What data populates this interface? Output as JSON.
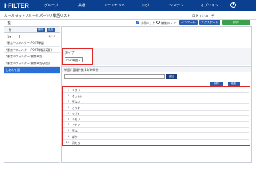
{
  "header": {
    "logo": "i-FILTER",
    "nav": [
      {
        "label": "グループ",
        "caret": "⌄"
      },
      {
        "label": "共通",
        "caret": "⌄"
      },
      {
        "label": "ルールセット",
        "caret": "⌄"
      },
      {
        "label": "ログ",
        "caret": "⌄"
      },
      {
        "label": "システム",
        "caret": "⌄"
      },
      {
        "label": "オプション",
        "caret": "⌄"
      }
    ],
    "power_icon": "power-icon"
  },
  "breadcrumb": "ルールセット / ルールパーツ / 単語リスト",
  "login_info": "ログインユーザー:",
  "toolbar": {
    "list_title": "一覧",
    "audit_lock_label": "参照ロック",
    "edit_lock_label": "編集ロック",
    "import_label": "インポート",
    "export_label": "エクスポート",
    "save_label": "保存"
  },
  "left_panel": {
    "header_label": "一覧",
    "delete_label": "削除",
    "add_label": "追加",
    "page_select": "1 ▾",
    "page_text": "1 / 10",
    "items": [
      {
        "label": "*暴言やフィルター:POST単語"
      },
      {
        "label": "*暴言やフィルター:POST単語(英語)"
      },
      {
        "label": "*暴言やフィルター:検閲単語"
      },
      {
        "label": "*暴言やフィルター:検閲単語(英語)"
      },
      {
        "label": "しあわせ語"
      }
    ]
  },
  "type_section": {
    "label": "タイプ",
    "selected": "POST単語 ▾"
  },
  "keyword_section": {
    "header": "単語 / 登録件数 10/300 件",
    "add_label": "追加",
    "delete_label": "削除",
    "edit_label": "編集",
    "rows": [
      {
        "no": "1",
        "text": "うざい"
      },
      {
        "no": "2",
        "text": "きしょい"
      },
      {
        "no": "3",
        "text": "死ねい"
      },
      {
        "no": "4",
        "text": "こわす"
      },
      {
        "no": "5",
        "text": "ウザイ"
      },
      {
        "no": "6",
        "text": "キモい"
      },
      {
        "no": "7",
        "text": "ヤキイ"
      },
      {
        "no": "8",
        "text": "死ね"
      },
      {
        "no": "9",
        "text": "ばか"
      },
      {
        "no": "10",
        "text": "消えろ"
      }
    ]
  },
  "colors": {
    "topbar": "#0b3f8f",
    "highlight": "#e02828",
    "active_item": "#2a6ed6",
    "save": "#3aa04b"
  }
}
